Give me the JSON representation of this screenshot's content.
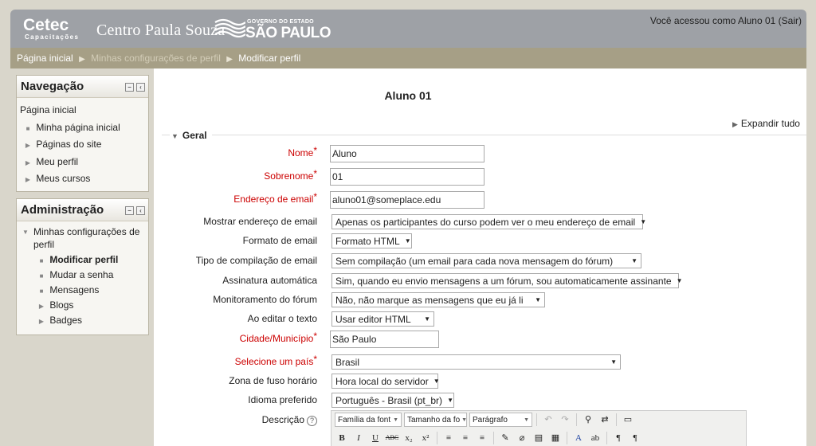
{
  "header": {
    "logo_cetec": "Cetec",
    "logo_cetec_sub": "Capacitações",
    "logo_cps": "Centro Paula Souza",
    "logo_gov": "GOVERNO DO ESTADO",
    "logo_sp": "SÃO PAULO",
    "login_info": "Você acessou como Aluno 01 (Sair)"
  },
  "breadcrumb": {
    "home": "Página inicial",
    "profile_settings": "Minhas configurações de perfil",
    "current": "Modificar perfil"
  },
  "nav_block": {
    "title": "Navegação",
    "home": "Página inicial",
    "items": [
      "Minha página inicial",
      "Páginas do site",
      "Meu perfil",
      "Meus cursos"
    ]
  },
  "admin_block": {
    "title": "Administração",
    "parent": "Minhas configurações de perfil",
    "items": [
      "Modificar perfil",
      "Mudar a senha",
      "Mensagens",
      "Blogs",
      "Badges"
    ]
  },
  "main": {
    "title": "Aluno 01",
    "expand_all": "Expandir tudo",
    "legend": "Geral"
  },
  "form": {
    "nome_label": "Nome",
    "nome_value": "Aluno",
    "sobrenome_label": "Sobrenome",
    "sobrenome_value": "01",
    "email_label": "Endereço de email",
    "email_value": "aluno01@someplace.edu",
    "show_email_label": "Mostrar endereço de email",
    "show_email_value": "Apenas os participantes do curso podem ver o meu endereço de email",
    "email_format_label": "Formato de email",
    "email_format_value": "Formato HTML",
    "digest_label": "Tipo de compilação de email",
    "digest_value": "Sem compilação (um email para cada nova mensagem do fórum)",
    "autosub_label": "Assinatura automática",
    "autosub_value": "Sim, quando eu envio mensagens a um fórum, sou automaticamente assinante",
    "tracking_label": "Monitoramento do fórum",
    "tracking_value": "Não, não marque as mensagens que eu já li",
    "editor_label": "Ao editar o texto",
    "editor_value": "Usar editor HTML",
    "city_label": "Cidade/Município",
    "city_value": "São Paulo",
    "country_label": "Selecione um país",
    "country_value": "Brasil",
    "timezone_label": "Zona de fuso horário",
    "timezone_value": "Hora local do servidor",
    "lang_label": "Idioma preferido",
    "lang_value": "Português - Brasil (pt_br)",
    "desc_label": "Descrição"
  },
  "editor_toolbar": {
    "font_family": "Família da font",
    "font_size": "Tamanho da fo",
    "paragraph": "Parágrafo"
  }
}
